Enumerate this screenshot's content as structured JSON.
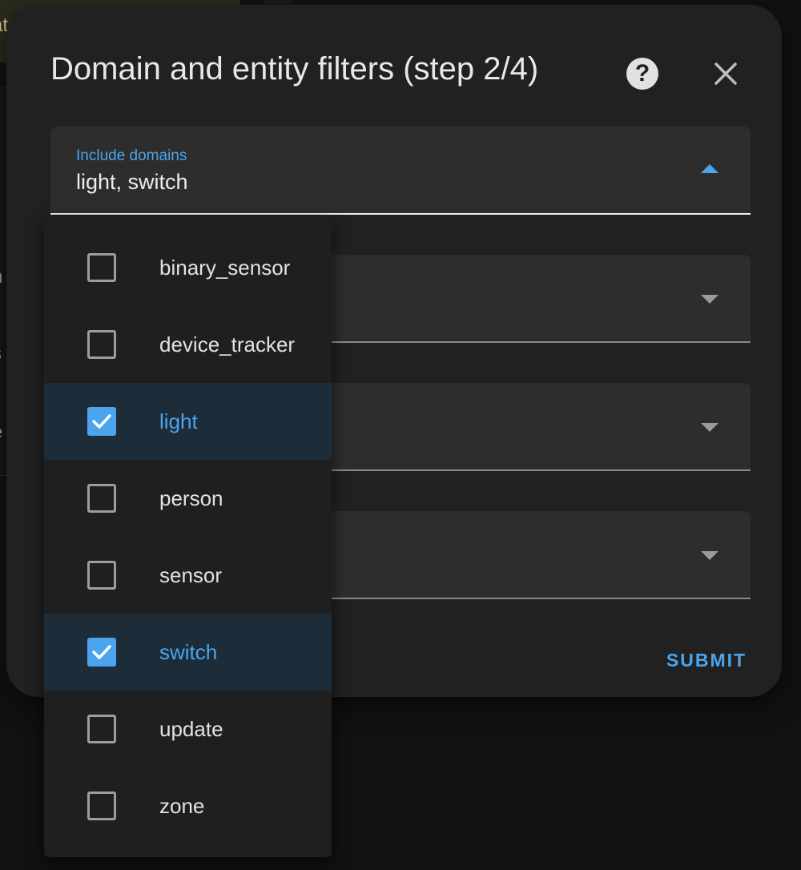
{
  "background": {
    "fragments": [
      "at",
      "n",
      "s",
      "e"
    ]
  },
  "dialog": {
    "title": "Domain and entity filters (step 2/4)",
    "help_icon": "?",
    "close_icon": "close-icon",
    "submit_label": "SUBMIT"
  },
  "fields": {
    "include_domains": {
      "label": "Include domains",
      "value": "light, switch"
    }
  },
  "menu": {
    "items": [
      {
        "label": "binary_sensor",
        "checked": false
      },
      {
        "label": "device_tracker",
        "checked": false
      },
      {
        "label": "light",
        "checked": true
      },
      {
        "label": "person",
        "checked": false
      },
      {
        "label": "sensor",
        "checked": false
      },
      {
        "label": "switch",
        "checked": true
      },
      {
        "label": "update",
        "checked": false
      },
      {
        "label": "zone",
        "checked": false
      }
    ]
  },
  "colors": {
    "accent": "#4aa5ee",
    "dialog_bg": "#212121",
    "field_bg": "#2d2d2d",
    "menu_bg": "#1f1f1f",
    "selected_bg": "#1c2c38"
  }
}
